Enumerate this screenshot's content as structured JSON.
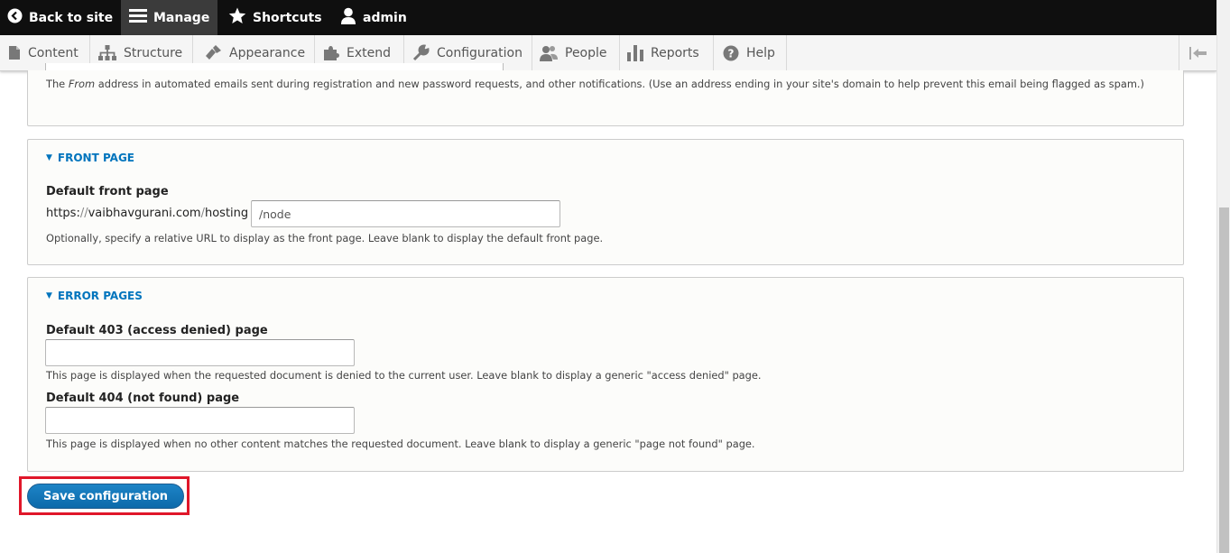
{
  "toolbar": {
    "back_to_site": "Back to site",
    "manage": "Manage",
    "shortcuts": "Shortcuts",
    "user": "admin"
  },
  "tray": {
    "items": [
      "Content",
      "Structure",
      "Appearance",
      "Extend",
      "Configuration",
      "People",
      "Reports",
      "Help"
    ]
  },
  "email_section": {
    "from_description_pre": "The ",
    "from_description_em": "From",
    "from_description_post": " address in automated emails sent during registration and new password requests, and other notifications. (Use an address ending in your site's domain to help prevent this email being flagged as spam.)"
  },
  "front_page": {
    "legend": "FRONT PAGE",
    "label": "Default front page",
    "prefix_scheme": "https:",
    "prefix_slashes": "//",
    "prefix_host": "vaibhavgurani.com",
    "prefix_sep": "/",
    "prefix_path": "hosting",
    "value": "/node",
    "description": "Optionally, specify a relative URL to display as the front page. Leave blank to display the default front page."
  },
  "error_pages": {
    "legend": "ERROR PAGES",
    "label_403": "Default 403 (access denied) page",
    "value_403": "",
    "description_403": "This page is displayed when the requested document is denied to the current user. Leave blank to display a generic \"access denied\" page.",
    "label_404": "Default 404 (not found) page",
    "value_404": "",
    "description_404": "This page is displayed when no other content matches the requested document. Leave blank to display a generic \"page not found\" page."
  },
  "actions": {
    "save": "Save configuration"
  },
  "colors": {
    "toolbar_bg": "#0f0f0f",
    "link_blue": "#0074bd",
    "button_blue": "#1d84c6",
    "highlight_red": "#e0172a"
  }
}
